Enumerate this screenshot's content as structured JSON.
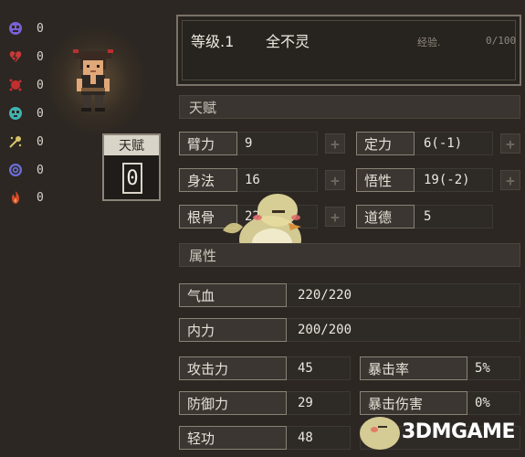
{
  "status_effects": [
    {
      "icon": "skull-icon",
      "color": "#7b5fd6",
      "value": "0"
    },
    {
      "icon": "broken-heart-icon",
      "color": "#c73a3a",
      "value": "0"
    },
    {
      "icon": "blood-splat-icon",
      "color": "#c22f2f",
      "value": "0"
    },
    {
      "icon": "poison-skull-icon",
      "color": "#3fb3b0",
      "value": "0"
    },
    {
      "icon": "stun-icon",
      "color": "#d8c46a",
      "value": "0"
    },
    {
      "icon": "confusion-icon",
      "color": "#6b6fd8",
      "value": "0"
    },
    {
      "icon": "fire-icon",
      "color": "#d24a2a",
      "value": "0"
    }
  ],
  "talent_box": {
    "title": "天赋",
    "value": "0"
  },
  "header": {
    "level": "等级.1",
    "name": "全不灵",
    "exp_label": "经验.",
    "exp_value": "0/100"
  },
  "sections": {
    "talent": "天赋",
    "attributes": "属性"
  },
  "talent_stats": [
    {
      "label": "臂力",
      "value": "9"
    },
    {
      "label": "定力",
      "value": "6(-1)"
    },
    {
      "label": "身法",
      "value": "16"
    },
    {
      "label": "悟性",
      "value": "19(-2)"
    },
    {
      "label": "根骨",
      "value": "22"
    },
    {
      "label": "道德",
      "value": "5"
    }
  ],
  "bars": [
    {
      "label": "气血",
      "value": "220/220"
    },
    {
      "label": "内力",
      "value": "200/200"
    }
  ],
  "combat_stats": [
    {
      "label": "攻击力",
      "value": "45"
    },
    {
      "label": "暴击率",
      "value": "5%"
    },
    {
      "label": "防御力",
      "value": "29"
    },
    {
      "label": "暴击伤害",
      "value": "0%"
    },
    {
      "label": "轻功",
      "value": "48"
    }
  ],
  "plus_symbol": "+",
  "watermark": "3DMGAME"
}
